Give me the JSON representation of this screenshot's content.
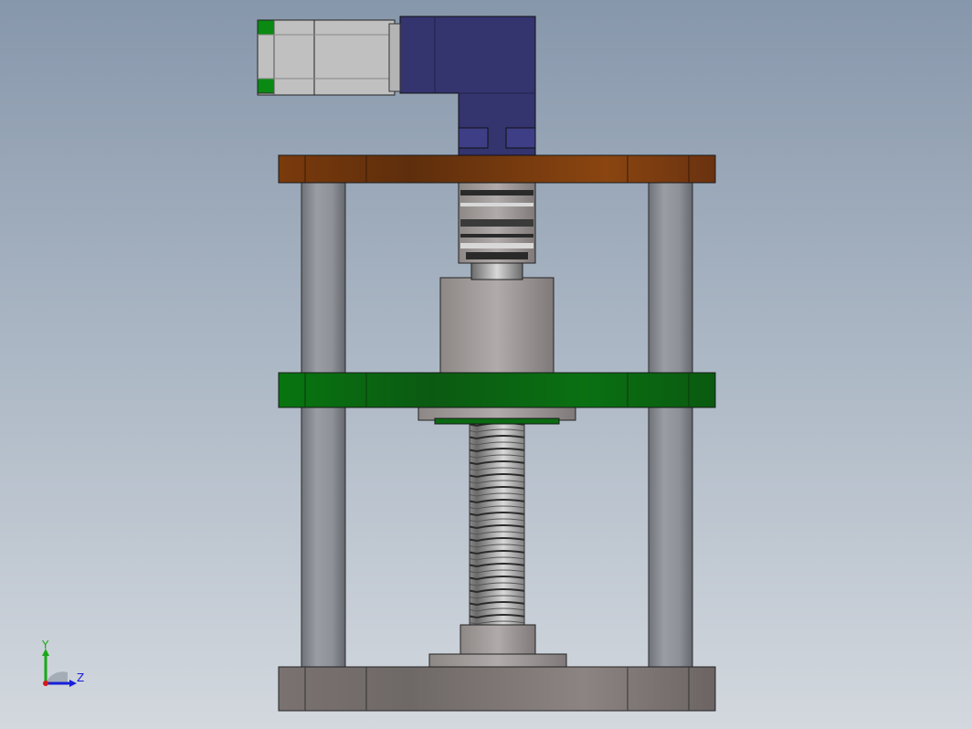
{
  "app": {
    "view": "cad-3d-viewport",
    "background_top": "#8797ab",
    "background_bottom": "#d3d8de"
  },
  "model": {
    "parts": [
      {
        "name": "servo-motor",
        "color": "#c0c0c0"
      },
      {
        "name": "right-angle-gearbox",
        "color": "#3a3a7a"
      },
      {
        "name": "top-plate",
        "color": "#8a4a16"
      },
      {
        "name": "coupling",
        "color": "#a8a8a8"
      },
      {
        "name": "bearing-housing",
        "color": "#a09c9a"
      },
      {
        "name": "moving-plate",
        "color": "#0a7a12"
      },
      {
        "name": "ball-screw",
        "color": "#b0b0b0"
      },
      {
        "name": "guide-column-left",
        "color": "#8d9096"
      },
      {
        "name": "guide-column-right",
        "color": "#8d9096"
      },
      {
        "name": "base-plate",
        "color": "#8c8480"
      }
    ]
  },
  "triad": {
    "y_label": "Y",
    "z_label": "Z",
    "y_color": "#18a818",
    "z_color": "#1820d8",
    "x_color": "#d81818"
  }
}
